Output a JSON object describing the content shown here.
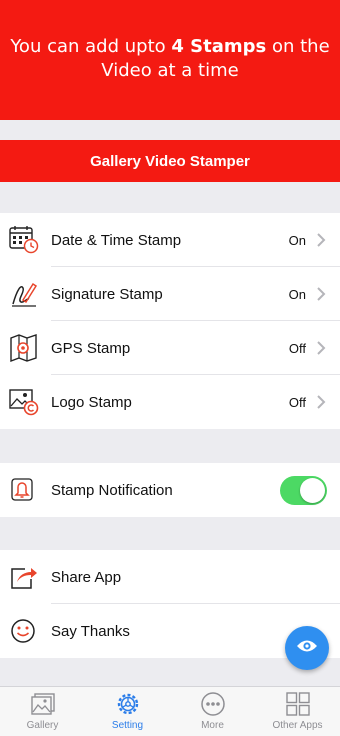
{
  "promo": {
    "pre": "You can add upto ",
    "bold": "4 Stamps",
    "post": " on the Video at a time"
  },
  "banner": {
    "label": "Gallery Video Stamper"
  },
  "stamps": [
    {
      "label": "Date & Time Stamp",
      "value": "On",
      "icon": "calendar-clock-icon"
    },
    {
      "label": "Signature Stamp",
      "value": "On",
      "icon": "signature-pen-icon"
    },
    {
      "label": "GPS Stamp",
      "value": "Off",
      "icon": "map-pin-icon"
    },
    {
      "label": "Logo Stamp",
      "value": "Off",
      "icon": "image-copyright-icon"
    }
  ],
  "notification": {
    "label": "Stamp Notification",
    "enabled": true,
    "icon": "bell-icon"
  },
  "misc": [
    {
      "label": "Share App",
      "icon": "share-icon"
    },
    {
      "label": "Say Thanks",
      "icon": "smile-icon"
    }
  ],
  "tabs": [
    {
      "label": "Gallery",
      "icon": "gallery-icon",
      "active": false
    },
    {
      "label": "Setting",
      "icon": "setting-gear-icon",
      "active": true
    },
    {
      "label": "More",
      "icon": "more-dots-icon",
      "active": false
    },
    {
      "label": "Other Apps",
      "icon": "grid-apps-icon",
      "active": false
    }
  ],
  "colors": {
    "accent_red": "#f41a12",
    "toggle_on": "#4cd964",
    "fab_blue": "#2f8ff0",
    "tab_active": "#2b7de9"
  }
}
